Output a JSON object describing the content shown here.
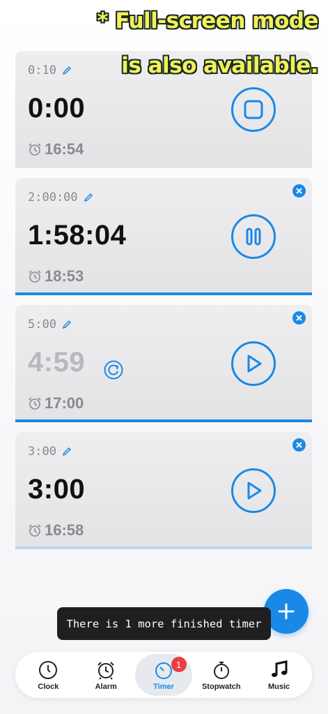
{
  "banner": {
    "line1": "* Full-screen mode",
    "line2": "is also available."
  },
  "timers": [
    {
      "set_time": "0:10",
      "remaining": "0:00",
      "end_time": "16:54",
      "state": "finished",
      "button": "stop",
      "progress": 0
    },
    {
      "set_time": "2:00:00",
      "remaining": "1:58:04",
      "end_time": "18:53",
      "state": "running",
      "button": "pause",
      "progress": 1.0
    },
    {
      "set_time": "5:00",
      "remaining": "4:59",
      "end_time": "17:00",
      "state": "paused",
      "button": "play",
      "progress": 1.0
    },
    {
      "set_time": "3:00",
      "remaining": "3:00",
      "end_time": "16:58",
      "state": "idle",
      "button": "play",
      "progress": 0
    }
  ],
  "toast": "There is 1 more finished timer",
  "tabs": [
    {
      "label": "Clock",
      "icon": "clock-icon"
    },
    {
      "label": "Alarm",
      "icon": "alarm-icon"
    },
    {
      "label": "Timer",
      "icon": "timer-icon",
      "badge": "1",
      "active": true
    },
    {
      "label": "Stopwatch",
      "icon": "stopwatch-icon"
    },
    {
      "label": "Music",
      "icon": "music-icon"
    }
  ],
  "colors": {
    "accent": "#1a88e6",
    "badge": "#ea3f3f"
  }
}
